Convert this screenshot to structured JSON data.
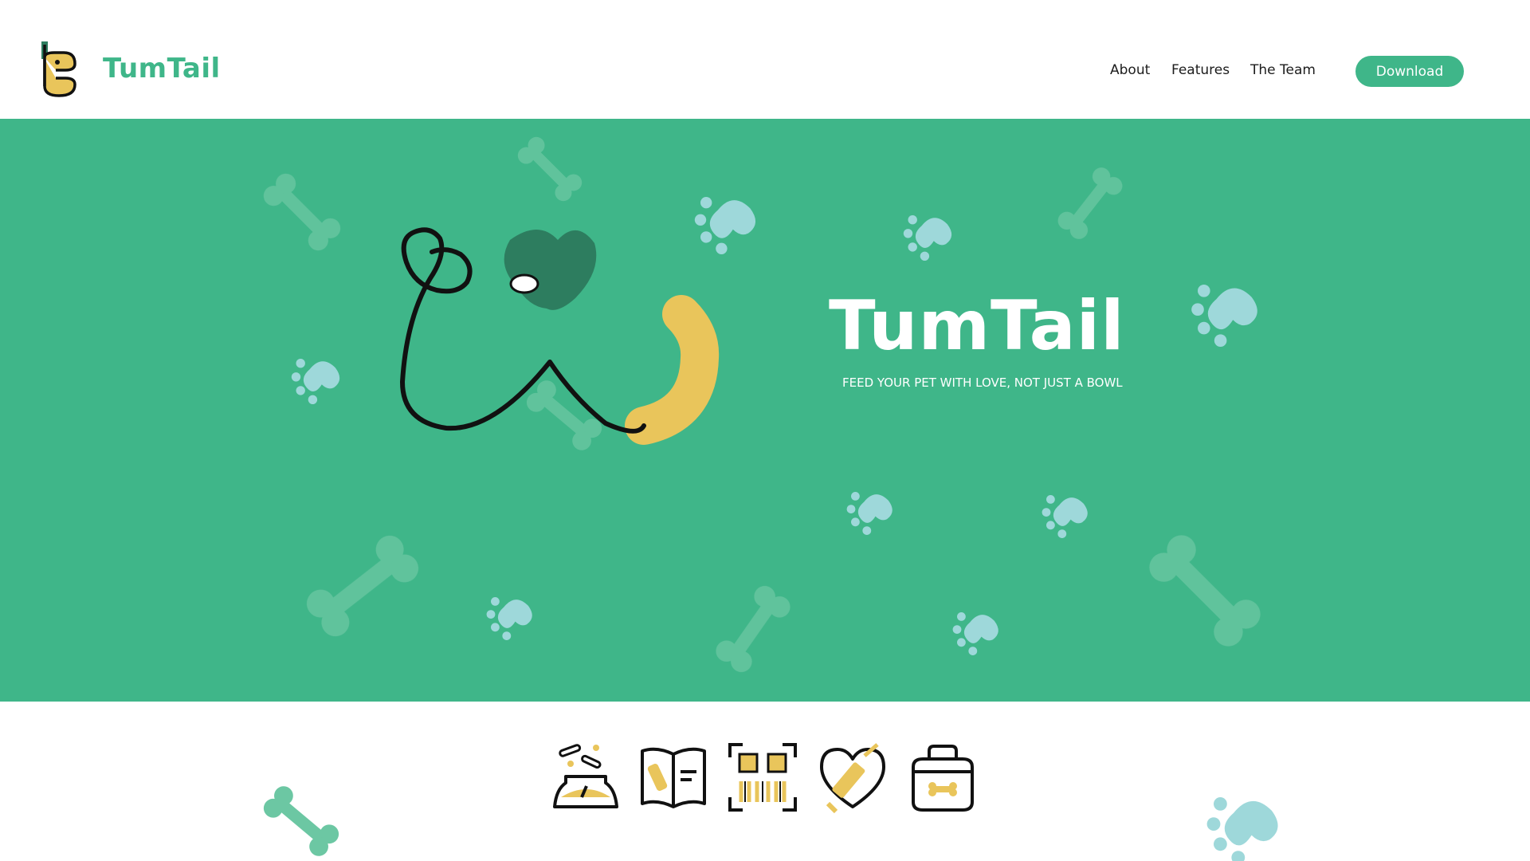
{
  "header": {
    "brand": "TumTail",
    "logo_icon": "tumtail-dog-logo-icon",
    "nav": [
      "About",
      "Features",
      "The Team"
    ],
    "download_label": "Download"
  },
  "hero": {
    "title": "TumTail",
    "tagline": "FEED YOUR PET WITH LOVE, NOT JUST A BOWL",
    "illustration": "dog-face-tail-illustration",
    "background_icons": [
      "bone-icon",
      "paw-icon"
    ]
  },
  "features": {
    "icons": [
      "food-bowl-icon",
      "recipe-book-icon",
      "qr-code-scan-icon",
      "heart-vaccine-icon",
      "pet-carrier-icon"
    ]
  },
  "colors": {
    "brand_green": "#3fb689",
    "dark_green": "#2d7d5f",
    "paw_blue": "#9ed8da",
    "bone_green": "#6cc7a3",
    "accent_yellow": "#e9c55b",
    "white": "#ffffff"
  }
}
